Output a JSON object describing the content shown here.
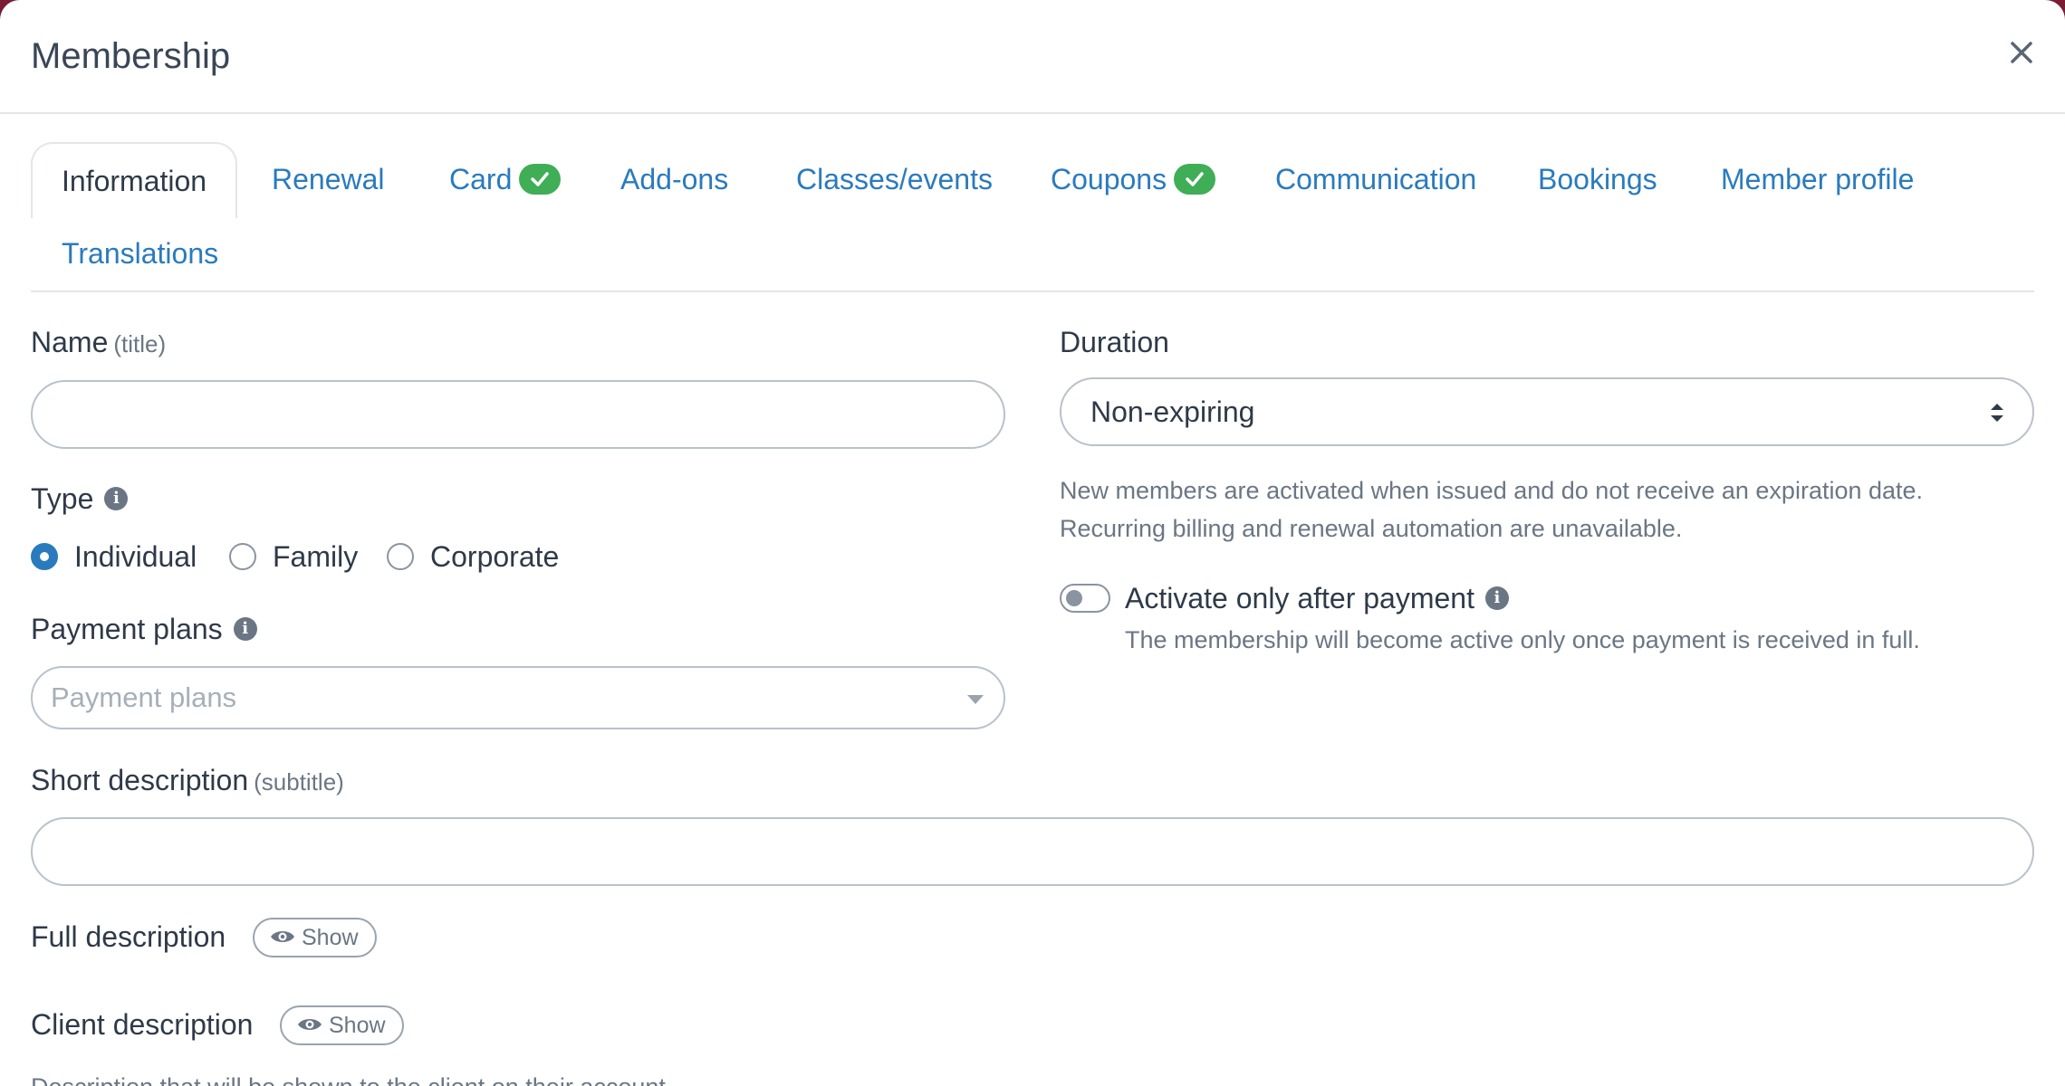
{
  "modal": {
    "title": "Membership"
  },
  "tabs": [
    {
      "label": "Information",
      "active": true,
      "complete": false
    },
    {
      "label": "Renewal",
      "active": false,
      "complete": false
    },
    {
      "label": "Card",
      "active": false,
      "complete": true
    },
    {
      "label": "Add-ons",
      "active": false,
      "complete": false
    },
    {
      "label": "Classes/events",
      "active": false,
      "complete": false
    },
    {
      "label": "Coupons",
      "active": false,
      "complete": true
    },
    {
      "label": "Communication",
      "active": false,
      "complete": false
    },
    {
      "label": "Bookings",
      "active": false,
      "complete": false
    },
    {
      "label": "Member profile",
      "active": false,
      "complete": false
    },
    {
      "label": "Translations",
      "active": false,
      "complete": false
    }
  ],
  "form": {
    "name": {
      "label": "Name",
      "hint": "(title)",
      "value": ""
    },
    "type": {
      "label": "Type",
      "options": [
        "Individual",
        "Family",
        "Corporate"
      ],
      "selected": "Individual"
    },
    "payment_plans": {
      "label": "Payment plans",
      "placeholder": "Payment plans"
    },
    "duration": {
      "label": "Duration",
      "value": "Non-expiring",
      "help_line1": "New members are activated when issued and do not receive an expiration date.",
      "help_line2": "Recurring billing and renewal automation are unavailable."
    },
    "activate_after_payment": {
      "label": "Activate only after payment",
      "enabled": false,
      "help": "The membership will become active only once payment is received in full."
    },
    "short_description": {
      "label": "Short description",
      "hint": "(subtitle)",
      "value": ""
    },
    "full_description": {
      "label": "Full description",
      "button": "Show"
    },
    "client_description": {
      "label": "Client description",
      "button": "Show",
      "help": "Description that will be shown to the client on their account"
    }
  },
  "colors": {
    "accent": "#2a7bbd",
    "success": "#3fae56",
    "backdrop": "#7b1c35",
    "text": "#2f3a48",
    "muted": "#6b7684"
  }
}
